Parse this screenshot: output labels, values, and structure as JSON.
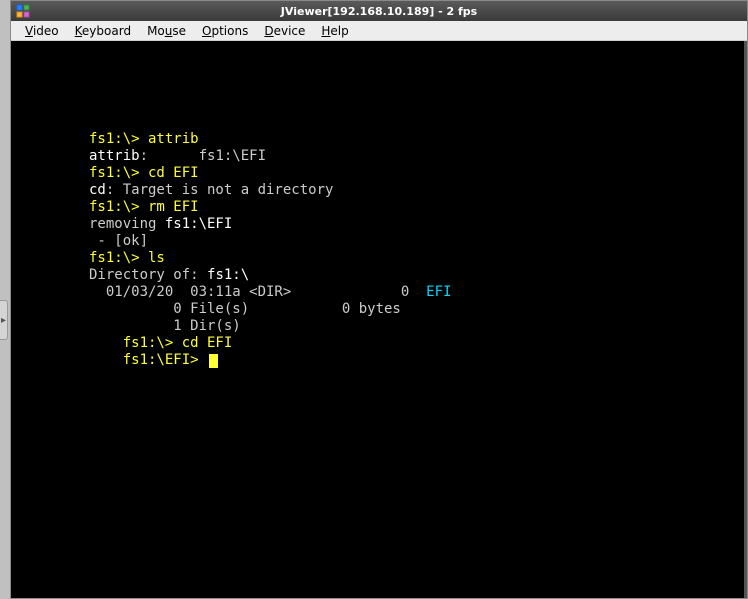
{
  "window": {
    "title": "JViewer[192.168.10.189] - 2 fps"
  },
  "menubar": {
    "items": [
      {
        "hotkey": "V",
        "rest": "ideo"
      },
      {
        "hotkey": "K",
        "rest": "eyboard"
      },
      {
        "hotkey": "M",
        "text_after_m": "o",
        "hotkey2": "u",
        "rest": "se"
      },
      {
        "hotkey": "O",
        "rest": "ptions"
      },
      {
        "hotkey": "D",
        "rest": "evice"
      },
      {
        "hotkey": "H",
        "rest": "elp"
      }
    ]
  },
  "terminal": {
    "lines": [
      {
        "segments": [
          {
            "cls": "t-yellow",
            "text": "fs1:\\> attrib"
          }
        ]
      },
      {
        "segments": [
          {
            "cls": "t-white",
            "text": "attrib"
          },
          {
            "cls": "t-gray",
            "text": ":      "
          },
          {
            "cls": "t-gray",
            "text": "fs1:\\EFI"
          }
        ]
      },
      {
        "segments": [
          {
            "cls": "t-gray",
            "text": ""
          }
        ]
      },
      {
        "segments": [
          {
            "cls": "t-yellow",
            "text": "fs1:\\> cd EFI"
          }
        ]
      },
      {
        "segments": [
          {
            "cls": "t-white",
            "text": "cd"
          },
          {
            "cls": "t-gray",
            "text": ": Target is not a directory"
          }
        ]
      },
      {
        "segments": [
          {
            "cls": "t-gray",
            "text": ""
          }
        ]
      },
      {
        "segments": [
          {
            "cls": "t-yellow",
            "text": "fs1:\\> rm EFI"
          }
        ]
      },
      {
        "segments": [
          {
            "cls": "t-gray",
            "text": "removing "
          },
          {
            "cls": "t-white",
            "text": "fs1:\\EFI"
          }
        ]
      },
      {
        "segments": [
          {
            "cls": "t-gray",
            "text": " - [ok]"
          }
        ]
      },
      {
        "segments": [
          {
            "cls": "t-gray",
            "text": ""
          }
        ]
      },
      {
        "segments": [
          {
            "cls": "t-yellow",
            "text": "fs1:\\> ls"
          }
        ]
      },
      {
        "segments": [
          {
            "cls": "t-gray",
            "text": "Directory of: "
          },
          {
            "cls": "t-white",
            "text": "fs1:\\"
          }
        ]
      },
      {
        "segments": [
          {
            "cls": "t-gray",
            "text": ""
          }
        ]
      },
      {
        "segments": [
          {
            "cls": "t-gray",
            "text": "  01/03/20  03:11a <DIR>             0  "
          },
          {
            "cls": "t-cyan",
            "text": "EFI"
          }
        ]
      },
      {
        "segments": [
          {
            "cls": "t-gray",
            "text": "          0 File(s)           0 bytes"
          }
        ]
      },
      {
        "segments": [
          {
            "cls": "t-gray",
            "text": "          1 Dir(s)"
          }
        ]
      },
      {
        "segments": [
          {
            "cls": "t-gray",
            "text": ""
          }
        ]
      },
      {
        "segments": [
          {
            "cls": "t-gray",
            "text": ""
          }
        ]
      },
      {
        "segments": [
          {
            "cls": "t-yellow",
            "text": "    fs1:\\> cd EFI"
          }
        ]
      },
      {
        "segments": [
          {
            "cls": "t-gray",
            "text": ""
          }
        ]
      },
      {
        "segments": [
          {
            "cls": "t-yellow",
            "text": "    fs1:\\EFI> "
          },
          {
            "cls": "cursor",
            "text": "",
            "isCursor": true
          }
        ]
      }
    ]
  },
  "side_tab_glyph": "▸"
}
